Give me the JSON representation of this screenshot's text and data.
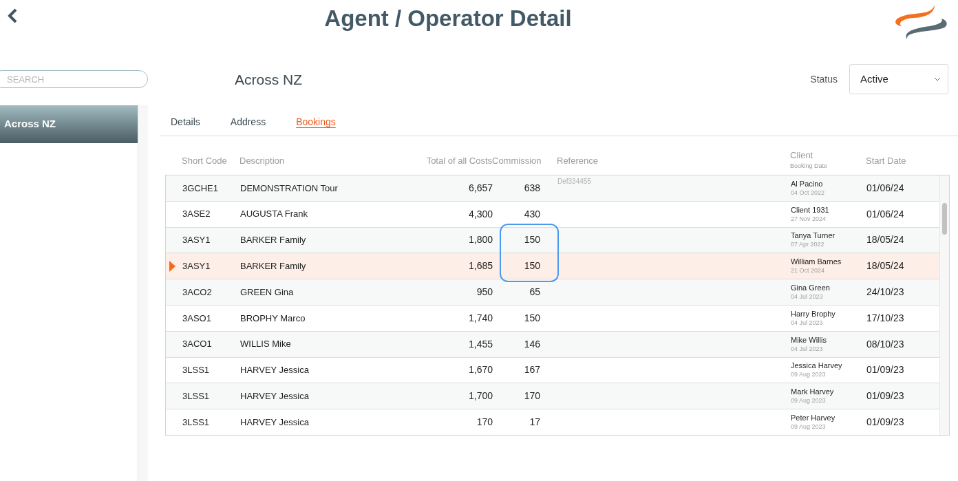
{
  "header": {
    "title": "Agent / Operator Detail"
  },
  "sidebar": {
    "search": {
      "placeholder": "SEARCH"
    },
    "items": [
      {
        "label": "Across NZ",
        "selected": true
      }
    ]
  },
  "detail": {
    "name": "Across NZ",
    "status": {
      "label": "Status",
      "value": "Active"
    }
  },
  "tabs": [
    {
      "label": "Details",
      "selected": false
    },
    {
      "label": "Address",
      "selected": false
    },
    {
      "label": "Bookings",
      "selected": true
    }
  ],
  "table": {
    "columns": [
      {
        "label": "Short Code"
      },
      {
        "label": "Description"
      },
      {
        "label": "Total of all Costs"
      },
      {
        "label": "Commission"
      },
      {
        "label": "Reference"
      },
      {
        "label": "Client",
        "sublabel": "Booking Date"
      },
      {
        "label": "Start Date"
      }
    ],
    "rows": [
      {
        "code": "3GCHE1",
        "description": "DEMONSTRATION Tour",
        "total": "6,657",
        "commission": "638",
        "reference": "Def334455",
        "client": "Al Pacino",
        "booking_date": "04 Oct 2022",
        "start": "01/06/24",
        "selected": false,
        "highlighted": false
      },
      {
        "code": "3ASE2",
        "description": "AUGUSTA Frank",
        "total": "4,300",
        "commission": "430",
        "client": "Client 1931",
        "booking_date": "27 Nov 2024",
        "start": "01/06/24",
        "selected": false,
        "highlighted": false
      },
      {
        "code": "3ASY1",
        "description": "BARKER Family",
        "total": "1,800",
        "commission": "150",
        "client": "Tanya Turner",
        "booking_date": "07 Apr 2022",
        "start": "18/05/24",
        "selected": false,
        "highlighted": true
      },
      {
        "code": "3ASY1",
        "description": "BARKER Family",
        "total": "1,685",
        "commission": "150",
        "client": "William Barnes",
        "booking_date": "21 Oct 2024",
        "start": "18/05/24",
        "selected": true,
        "highlighted": true
      },
      {
        "code": "3ACO2",
        "description": "GREEN Gina",
        "total": "950",
        "commission": "65",
        "client": "Gina Green",
        "booking_date": "04 Jul 2023",
        "start": "24/10/23",
        "selected": false,
        "highlighted": false
      },
      {
        "code": "3ASO1",
        "description": "BROPHY Marco",
        "total": "1,740",
        "commission": "150",
        "client": "Harry Brophy",
        "booking_date": "04 Jul 2023",
        "start": "17/10/23",
        "selected": false,
        "highlighted": false
      },
      {
        "code": "3ACO1",
        "description": "WILLIS Mike",
        "total": "1,455",
        "commission": "146",
        "client": "Mike Willis",
        "booking_date": "04 Jul 2023",
        "start": "08/10/23",
        "selected": false,
        "highlighted": false
      },
      {
        "code": "3LSS1",
        "description": "HARVEY Jessica",
        "total": "1,670",
        "commission": "167",
        "client": "Jessica Harvey",
        "booking_date": "09 Aug 2023",
        "start": "01/09/23",
        "selected": false,
        "highlighted": false
      },
      {
        "code": "3LSS1",
        "description": "HARVEY Jessica",
        "total": "1,700",
        "commission": "170",
        "client": "Mark Harvey",
        "booking_date": "09 Aug 2023",
        "start": "01/09/23",
        "selected": false,
        "highlighted": false
      },
      {
        "code": "3LSS1",
        "description": "HARVEY Jessica",
        "total": "170",
        "commission": "17",
        "client": "Peter Harvey",
        "booking_date": "09 Aug 2023",
        "start": "01/09/23",
        "selected": false,
        "highlighted": false
      }
    ]
  }
}
